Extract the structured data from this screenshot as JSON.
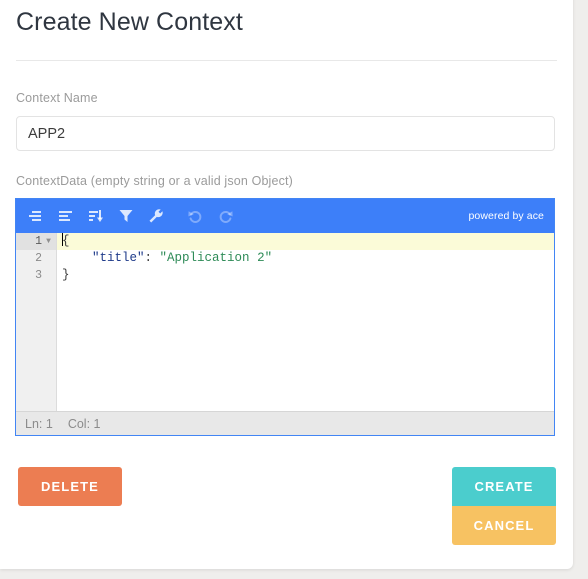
{
  "page": {
    "title": "Create New Context"
  },
  "form": {
    "context_name": {
      "label": "Context Name",
      "value": "APP2",
      "placeholder": "Context Name"
    },
    "context_data": {
      "label": "ContextData (empty string or a valid json Object)"
    }
  },
  "editor": {
    "branding": "powered by ace",
    "toolbar": [
      {
        "name": "compact-json-icon",
        "title": "Compact JSON data"
      },
      {
        "name": "format-json-icon",
        "title": "Format JSON data"
      },
      {
        "name": "sort-icon",
        "title": "Sort contents"
      },
      {
        "name": "filter-icon",
        "title": "Filter, sort or transform contents"
      },
      {
        "name": "repair-icon",
        "title": "Repair JSON"
      },
      {
        "name": "undo-icon",
        "title": "Undo last action"
      },
      {
        "name": "redo-icon",
        "title": "Redo"
      }
    ],
    "lines": [
      {
        "number": "1",
        "foldable": true,
        "active": true
      },
      {
        "number": "2",
        "foldable": false,
        "active": false
      },
      {
        "number": "3",
        "foldable": false,
        "active": false
      }
    ],
    "code": {
      "line1_punct": "{",
      "line2_key": "\"title\"",
      "line2_colon": ": ",
      "line2_value": "\"Application 2\"",
      "line2_indent": "    ",
      "line3_punct": "}"
    },
    "status": {
      "line": "Ln: 1",
      "column": "Col: 1"
    }
  },
  "actions": {
    "delete_label": "DELETE",
    "create_label": "CREATE",
    "cancel_label": "CANCEL"
  },
  "colors": {
    "toolbar_blue": "#3d7ff9",
    "editor_border": "#4285f4",
    "delete": "#ec7d52",
    "create": "#4bcdcd",
    "cancel": "#f7c262",
    "active_line": "#fbfbd8",
    "json_key": "#1e3a8a",
    "json_string": "#2e8b57"
  }
}
